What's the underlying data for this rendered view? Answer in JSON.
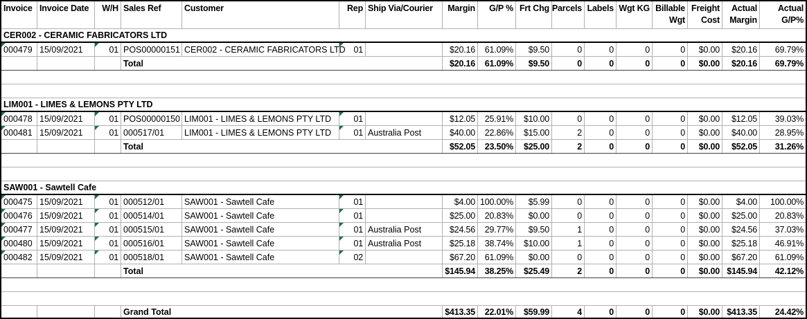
{
  "report": {
    "flag_color": "#1e7145",
    "grid_color": "#b0b0b0",
    "total_label": "Total",
    "grand_total_label": "Grand Total",
    "flag_columns": [
      "invoice",
      "wh",
      "rep"
    ],
    "columns": [
      {
        "id": "invoice",
        "label_lines": [
          "Invoice"
        ],
        "align": "left"
      },
      {
        "id": "invoice_date",
        "label_lines": [
          "Invoice Date"
        ],
        "align": "left"
      },
      {
        "id": "wh",
        "label_lines": [
          "W/H"
        ],
        "align": "right"
      },
      {
        "id": "sales_ref",
        "label_lines": [
          "Sales Ref"
        ],
        "align": "left"
      },
      {
        "id": "customer",
        "label_lines": [
          "Customer"
        ],
        "align": "left"
      },
      {
        "id": "rep",
        "label_lines": [
          "Rep"
        ],
        "align": "right"
      },
      {
        "id": "ship_via",
        "label_lines": [
          "Ship Via/Courier"
        ],
        "align": "left"
      },
      {
        "id": "margin",
        "label_lines": [
          "Margin"
        ],
        "align": "right"
      },
      {
        "id": "gp_pct",
        "label_lines": [
          "G/P %"
        ],
        "align": "right"
      },
      {
        "id": "frt_chg",
        "label_lines": [
          "Frt Chg"
        ],
        "align": "right"
      },
      {
        "id": "parcels",
        "label_lines": [
          "Parcels"
        ],
        "align": "right"
      },
      {
        "id": "labels",
        "label_lines": [
          "Labels"
        ],
        "align": "right"
      },
      {
        "id": "wgt_kg",
        "label_lines": [
          "Wgt KG"
        ],
        "align": "right"
      },
      {
        "id": "billable_wgt",
        "label_lines": [
          "Billable",
          "Wgt"
        ],
        "align": "right"
      },
      {
        "id": "freight_cost",
        "label_lines": [
          "Freight",
          "Cost"
        ],
        "align": "right"
      },
      {
        "id": "actual_margin",
        "label_lines": [
          "Actual",
          "Margin"
        ],
        "align": "right"
      },
      {
        "id": "actual_gp_pct",
        "label_lines": [
          "Actual",
          "G/P%"
        ],
        "align": "right"
      }
    ],
    "groups": [
      {
        "header": "CER002 - CERAMIC FABRICATORS LTD",
        "rows": [
          {
            "invoice": "000479",
            "invoice_date": "15/09/2021",
            "wh": "01",
            "sales_ref": "POS00000151",
            "customer": "CER002 - CERAMIC FABRICATORS LTD",
            "rep": "01",
            "ship_via": "",
            "margin": "$20.16",
            "gp_pct": "61.09%",
            "frt_chg": "$9.50",
            "parcels": "0",
            "labels": "0",
            "wgt_kg": "0",
            "billable_wgt": "0",
            "freight_cost": "$0.00",
            "actual_margin": "$20.16",
            "actual_gp_pct": "69.79%"
          }
        ],
        "total": {
          "margin": "$20.16",
          "gp_pct": "61.09%",
          "frt_chg": "$9.50",
          "parcels": "0",
          "labels": "0",
          "wgt_kg": "0",
          "billable_wgt": "0",
          "freight_cost": "$0.00",
          "actual_margin": "$20.16",
          "actual_gp_pct": "69.79%"
        }
      },
      {
        "header": "LIM001 - LIMES & LEMONS PTY LTD",
        "rows": [
          {
            "invoice": "000478",
            "invoice_date": "15/09/2021",
            "wh": "01",
            "sales_ref": "POS00000150",
            "customer": "LIM001 - LIMES & LEMONS PTY LTD",
            "rep": "01",
            "ship_via": "",
            "margin": "$12.05",
            "gp_pct": "25.91%",
            "frt_chg": "$10.00",
            "parcels": "0",
            "labels": "0",
            "wgt_kg": "0",
            "billable_wgt": "0",
            "freight_cost": "$0.00",
            "actual_margin": "$12.05",
            "actual_gp_pct": "39.03%"
          },
          {
            "invoice": "000481",
            "invoice_date": "15/09/2021",
            "wh": "01",
            "sales_ref": "000517/01",
            "customer": "LIM001 - LIMES & LEMONS PTY LTD",
            "rep": "01",
            "ship_via": "Australia Post",
            "margin": "$40.00",
            "gp_pct": "22.86%",
            "frt_chg": "$15.00",
            "parcels": "2",
            "labels": "0",
            "wgt_kg": "0",
            "billable_wgt": "0",
            "freight_cost": "$0.00",
            "actual_margin": "$40.00",
            "actual_gp_pct": "28.95%"
          }
        ],
        "total": {
          "margin": "$52.05",
          "gp_pct": "23.50%",
          "frt_chg": "$25.00",
          "parcels": "2",
          "labels": "0",
          "wgt_kg": "0",
          "billable_wgt": "0",
          "freight_cost": "$0.00",
          "actual_margin": "$52.05",
          "actual_gp_pct": "31.26%"
        }
      },
      {
        "header": "SAW001 - Sawtell Cafe",
        "rows": [
          {
            "invoice": "000475",
            "invoice_date": "15/09/2021",
            "wh": "01",
            "sales_ref": "000512/01",
            "customer": "SAW001 - Sawtell Cafe",
            "rep": "01",
            "ship_via": "",
            "margin": "$4.00",
            "gp_pct": "100.00%",
            "frt_chg": "$5.99",
            "parcels": "0",
            "labels": "0",
            "wgt_kg": "0",
            "billable_wgt": "0",
            "freight_cost": "$0.00",
            "actual_margin": "$4.00",
            "actual_gp_pct": "100.00%"
          },
          {
            "invoice": "000476",
            "invoice_date": "15/09/2021",
            "wh": "01",
            "sales_ref": "000514/01",
            "customer": "SAW001 - Sawtell Cafe",
            "rep": "01",
            "ship_via": "",
            "margin": "$25.00",
            "gp_pct": "20.83%",
            "frt_chg": "$0.00",
            "parcels": "0",
            "labels": "0",
            "wgt_kg": "0",
            "billable_wgt": "0",
            "freight_cost": "$0.00",
            "actual_margin": "$25.00",
            "actual_gp_pct": "20.83%"
          },
          {
            "invoice": "000477",
            "invoice_date": "15/09/2021",
            "wh": "01",
            "sales_ref": "000515/01",
            "customer": "SAW001 - Sawtell Cafe",
            "rep": "01",
            "ship_via": "Australia Post",
            "margin": "$24.56",
            "gp_pct": "29.77%",
            "frt_chg": "$9.50",
            "parcels": "1",
            "labels": "0",
            "wgt_kg": "0",
            "billable_wgt": "0",
            "freight_cost": "$0.00",
            "actual_margin": "$24.56",
            "actual_gp_pct": "37.03%"
          },
          {
            "invoice": "000480",
            "invoice_date": "15/09/2021",
            "wh": "01",
            "sales_ref": "000516/01",
            "customer": "SAW001 - Sawtell Cafe",
            "rep": "01",
            "ship_via": "Australia Post",
            "margin": "$25.18",
            "gp_pct": "38.74%",
            "frt_chg": "$10.00",
            "parcels": "1",
            "labels": "0",
            "wgt_kg": "0",
            "billable_wgt": "0",
            "freight_cost": "$0.00",
            "actual_margin": "$25.18",
            "actual_gp_pct": "46.91%"
          },
          {
            "invoice": "000482",
            "invoice_date": "15/09/2021",
            "wh": "01",
            "sales_ref": "000518/01",
            "customer": "SAW001 - Sawtell Cafe",
            "rep": "02",
            "ship_via": "",
            "margin": "$67.20",
            "gp_pct": "61.09%",
            "frt_chg": "$0.00",
            "parcels": "0",
            "labels": "0",
            "wgt_kg": "0",
            "billable_wgt": "0",
            "freight_cost": "$0.00",
            "actual_margin": "$67.20",
            "actual_gp_pct": "61.09%"
          }
        ],
        "total": {
          "margin": "$145.94",
          "gp_pct": "38.25%",
          "frt_chg": "$25.49",
          "parcels": "2",
          "labels": "0",
          "wgt_kg": "0",
          "billable_wgt": "0",
          "freight_cost": "$0.00",
          "actual_margin": "$145.94",
          "actual_gp_pct": "42.12%"
        }
      }
    ],
    "grand_total": {
      "margin": "$413.35",
      "gp_pct": "22.01%",
      "frt_chg": "$59.99",
      "parcels": "4",
      "labels": "0",
      "wgt_kg": "0",
      "billable_wgt": "0",
      "freight_cost": "$0.00",
      "actual_margin": "$413.35",
      "actual_gp_pct": "24.42%"
    }
  }
}
